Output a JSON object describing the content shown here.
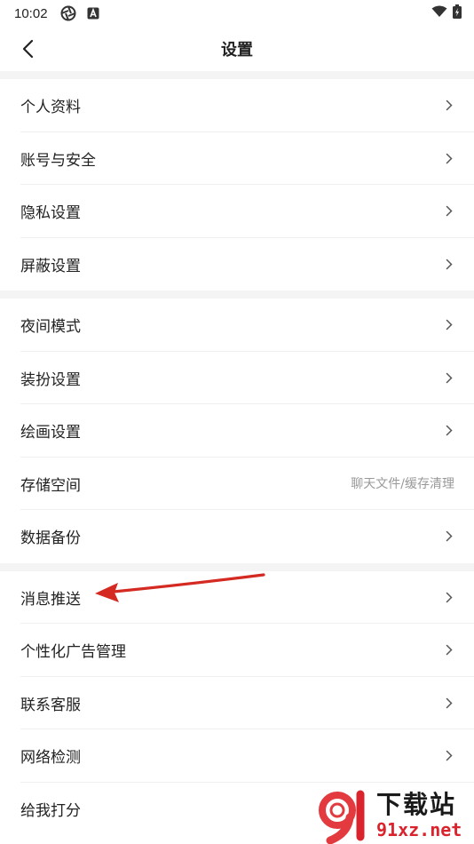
{
  "status_bar": {
    "time": "10:02"
  },
  "header": {
    "title": "设置"
  },
  "sections": [
    {
      "items": [
        {
          "label": "个人资料"
        },
        {
          "label": "账号与安全"
        },
        {
          "label": "隐私设置"
        },
        {
          "label": "屏蔽设置"
        }
      ]
    },
    {
      "items": [
        {
          "label": "夜间模式"
        },
        {
          "label": "装扮设置"
        },
        {
          "label": "绘画设置"
        },
        {
          "label": "存储空间",
          "hint": "聊天文件/缓存清理"
        },
        {
          "label": "数据备份"
        }
      ]
    },
    {
      "items": [
        {
          "label": "消息推送"
        },
        {
          "label": "个性化广告管理"
        },
        {
          "label": "联系客服"
        },
        {
          "label": "网络检测"
        },
        {
          "label": "给我打分"
        }
      ]
    }
  ],
  "annotation": {
    "color": "#d42a22"
  },
  "watermark": {
    "title": "下载站",
    "url": "91xz.net",
    "logo_mark": "91"
  }
}
